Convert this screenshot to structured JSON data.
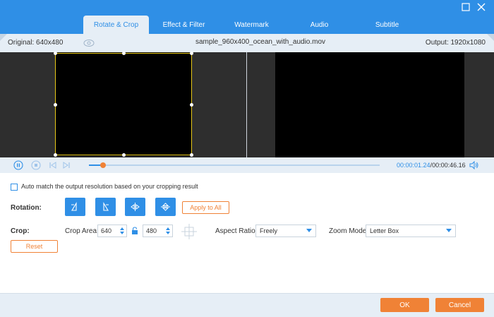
{
  "tabs": [
    {
      "label": "Rotate & Crop",
      "active": true
    },
    {
      "label": "Effect & Filter",
      "active": false
    },
    {
      "label": "Watermark",
      "active": false
    },
    {
      "label": "Audio",
      "active": false
    },
    {
      "label": "Subtitle",
      "active": false
    }
  ],
  "window": {
    "maximize_icon": "maximize-icon",
    "close_icon": "close-icon"
  },
  "info": {
    "original": "Original: 640x480",
    "filename": "sample_960x400_ocean_with_audio.mov",
    "output": "Output: 1920x1080",
    "eye_icon": "eye-icon"
  },
  "player": {
    "current_time": "00:00:01.24",
    "separator": "/",
    "total_time": "00:00:46.16",
    "progress": 0.05
  },
  "options": {
    "auto_match_label": "Auto match the output resolution based on your cropping result",
    "auto_match_checked": false
  },
  "rotation": {
    "label": "Rotation:",
    "apply_all": "Apply to All"
  },
  "crop": {
    "label": "Crop:",
    "area_label": "Crop Area:",
    "width": "640",
    "height": "480",
    "aspect_label": "Aspect Ratio:",
    "aspect_value": "Freely",
    "zoom_label": "Zoom Mode:",
    "zoom_value": "Letter Box",
    "reset": "Reset"
  },
  "footer": {
    "ok": "OK",
    "cancel": "Cancel"
  },
  "colors": {
    "accent": "#2f8fe6",
    "orange": "#f08236",
    "crop_border": "#e8c818"
  }
}
